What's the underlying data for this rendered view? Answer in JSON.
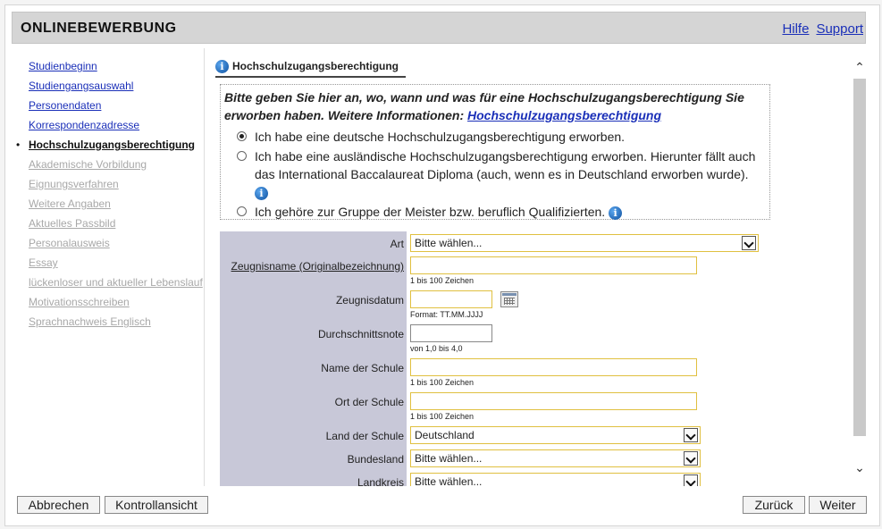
{
  "header": {
    "title": "ONLINEBEWERBUNG",
    "links": [
      "Hilfe",
      "Support"
    ]
  },
  "nav": {
    "items": [
      {
        "label": "Studienbeginn",
        "state": "link"
      },
      {
        "label": "Studiengangsauswahl",
        "state": "link"
      },
      {
        "label": "Personendaten",
        "state": "link"
      },
      {
        "label": "Korrespondenzadresse",
        "state": "link"
      },
      {
        "label": "Hochschulzugangsberechtigung",
        "state": "current"
      },
      {
        "label": "Akademische Vorbildung",
        "state": "disabled"
      },
      {
        "label": "Eignungsverfahren",
        "state": "disabled"
      },
      {
        "label": "Weitere Angaben",
        "state": "disabled"
      },
      {
        "label": "Aktuelles Passbild",
        "state": "disabled"
      },
      {
        "label": "Personalausweis",
        "state": "disabled"
      },
      {
        "label": "Essay",
        "state": "disabled"
      },
      {
        "label": "lückenloser und aktueller Lebenslauf",
        "state": "disabled"
      },
      {
        "label": "Motivationsschreiben",
        "state": "disabled"
      },
      {
        "label": "Sprachnachweis Englisch",
        "state": "disabled"
      }
    ]
  },
  "tab": {
    "label": "Hochschulzugangsberechtigung"
  },
  "intro": {
    "text": "Bitte geben Sie hier an, wo, wann und was für eine Hochschulzugangsberechtigung Sie erworben haben. Weitere Informationen: ",
    "link": "Hochschulzugangsberechtigung"
  },
  "options": [
    {
      "label": "Ich habe eine deutsche Hochschulzugangsberechtigung erworben.",
      "checked": true
    },
    {
      "label": "Ich habe eine ausländische Hochschulzugangsberechtigung erworben. Hierunter fällt auch das International Baccalaureat Diploma (auch, wenn es in Deutschland erworben wurde).",
      "checked": false
    },
    {
      "label": "Ich gehöre zur Gruppe der Meister bzw. beruflich Qualifizierten.",
      "checked": false
    }
  ],
  "form": {
    "art": {
      "label": "Art",
      "value": "Bitte wählen..."
    },
    "zeugnisname": {
      "label": "Zeugnisname (Originalbezeichnung)",
      "hint": "1 bis 100 Zeichen",
      "value": ""
    },
    "zeugnisdatum": {
      "label": "Zeugnisdatum",
      "hint": "Format: TT.MM.JJJJ",
      "value": ""
    },
    "durchschnittsnote": {
      "label": "Durchschnittsnote",
      "hint": "von 1,0 bis 4,0",
      "value": ""
    },
    "schulname": {
      "label": "Name der Schule",
      "hint": "1 bis 100 Zeichen",
      "value": ""
    },
    "schulort": {
      "label": "Ort der Schule",
      "hint": "1 bis 100 Zeichen",
      "value": ""
    },
    "land": {
      "label": "Land der Schule",
      "value": "Deutschland"
    },
    "bundesland": {
      "label": "Bundesland",
      "value": "Bitte wählen..."
    },
    "landkreis": {
      "label": "Landkreis",
      "value": "Bitte wählen..."
    }
  },
  "footer": {
    "cancel": "Abbrechen",
    "overview": "Kontrollansicht",
    "back": "Zurück",
    "next": "Weiter"
  },
  "colors": {
    "label_column": "#c8c8d8",
    "input_border": "#e0c040",
    "link": "#1a2fb8"
  }
}
